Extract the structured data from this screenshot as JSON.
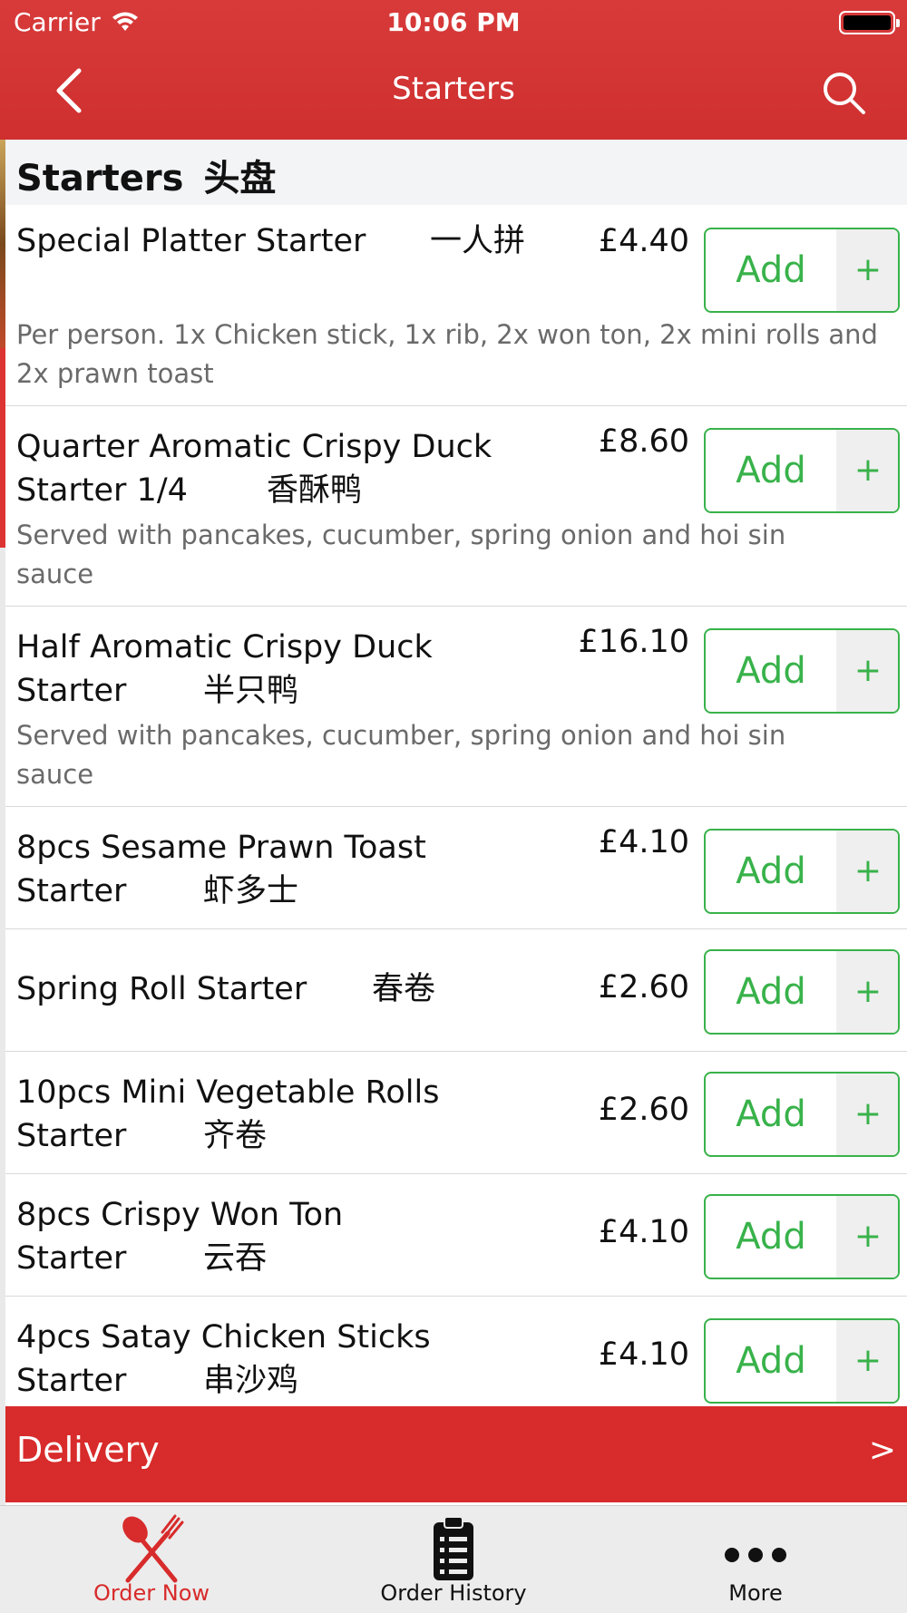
{
  "status_bar": {
    "carrier": "Carrier",
    "time": "10:06 PM"
  },
  "nav": {
    "title": "Starters"
  },
  "section": {
    "title": "Starters",
    "title_cn": "头盘"
  },
  "items": [
    {
      "name": "Special Platter Starter",
      "name_cn": "一人拼",
      "price": "£4.40",
      "description": "Per person. 1x Chicken stick, 1x rib, 2x won ton, 2x mini rolls and 2x prawn toast"
    },
    {
      "name_line1": "Quarter Aromatic Crispy Duck",
      "name_line2": "Starter 1/4",
      "name_cn": "香酥鸭",
      "price": "£8.60",
      "description": "Served with pancakes, cucumber, spring onion and hoi sin sauce"
    },
    {
      "name_line1": "Half Aromatic Crispy Duck",
      "name_line2": "Starter",
      "name_cn": "半只鸭",
      "price": "£16.10",
      "description": "Served with pancakes, cucumber, spring onion and hoi sin sauce"
    },
    {
      "name_line1": "8pcs Sesame Prawn Toast",
      "name_line2": "Starter",
      "name_cn": "虾多士",
      "price": "£4.10"
    },
    {
      "name": "Spring Roll Starter",
      "name_cn": "春卷",
      "price": "£2.60"
    },
    {
      "name_line1": "10pcs Mini Vegetable Rolls",
      "name_line2": "Starter",
      "name_cn": "齐卷",
      "price": "£2.60"
    },
    {
      "name_line1": "8pcs Crispy Won Ton",
      "name_line2": "Starter",
      "name_cn": "云吞",
      "price": "£4.10"
    },
    {
      "name_line1": "4pcs Satay Chicken Sticks",
      "name_line2": "Starter",
      "name_cn": "串沙鸡",
      "price": "£4.10"
    }
  ],
  "add_button": {
    "label": "Add",
    "plus": "+"
  },
  "delivery_bar": {
    "label": "Delivery",
    "arrow": ">"
  },
  "tabs": [
    {
      "label": "Order Now",
      "icon": "fork-knife-icon",
      "active": true
    },
    {
      "label": "Order History",
      "icon": "clipboard-icon",
      "active": false
    },
    {
      "label": "More",
      "icon": "more-dots-icon",
      "active": false
    }
  ],
  "colors": {
    "header_red": "#d83a3a",
    "delivery_red": "#d82b2b",
    "add_green": "#38b24a",
    "active_tab": "#d82b2b"
  }
}
